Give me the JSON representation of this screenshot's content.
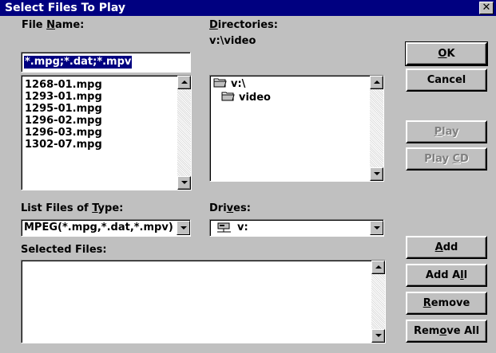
{
  "window": {
    "title": "Select Files To Play",
    "close_glyph": "✕"
  },
  "file_name": {
    "label_pre": "File ",
    "label_key": "N",
    "label_post": "ame:",
    "value": "*.mpg;*.dat;*.mpv"
  },
  "files": [
    "1268-01.mpg",
    "1293-01.mpg",
    "1295-01.mpg",
    "1296-02.mpg",
    "1296-03.mpg",
    "1302-07.mpg"
  ],
  "directories": {
    "label_key": "D",
    "label_post": "irectories:",
    "current": "v:\\video",
    "items": [
      {
        "name": "v:\\",
        "icon": "open-folder-icon"
      },
      {
        "name": "video",
        "icon": "open-folder-icon"
      }
    ]
  },
  "file_type": {
    "label_pre": "List Files of ",
    "label_key": "T",
    "label_post": "ype:",
    "value": "MPEG(*.mpg,*.dat,*.mpv)"
  },
  "drives": {
    "label_pre": "Dri",
    "label_key": "v",
    "label_post": "es:",
    "value": "v:",
    "icon": "network-drive-icon"
  },
  "selected_files": {
    "label": "Selected Files:",
    "items": []
  },
  "buttons": {
    "ok": {
      "pre": "",
      "key": "O",
      "post": "K"
    },
    "cancel": {
      "label": "Cancel"
    },
    "play": {
      "pre": "",
      "key": "P",
      "post": "lay"
    },
    "play_cd": {
      "pre": "Play ",
      "key": "C",
      "post": "D"
    },
    "add": {
      "pre": "",
      "key": "A",
      "post": "dd"
    },
    "add_all": {
      "pre": "Add A",
      "key": "l",
      "post": "l"
    },
    "remove": {
      "pre": "",
      "key": "R",
      "post": "emove"
    },
    "remove_all": {
      "pre": "Rem",
      "key": "o",
      "post": "ve All"
    }
  },
  "colors": {
    "titlebar": "#000080",
    "face": "#c0c0c0",
    "selection": "#000080"
  }
}
